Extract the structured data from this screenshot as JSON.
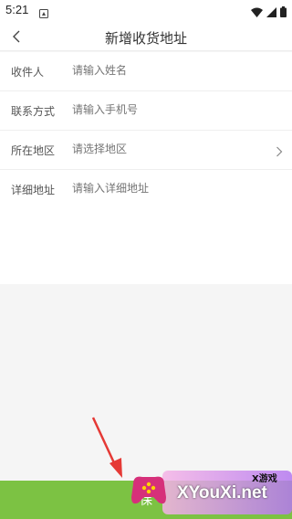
{
  "status_bar": {
    "time": "5:21"
  },
  "header": {
    "title": "新增收货地址"
  },
  "form": {
    "rows": [
      {
        "label": "收件人",
        "placeholder": "请输入姓名"
      },
      {
        "label": "联系方式",
        "placeholder": "请输入手机号"
      },
      {
        "label": "所在地区",
        "placeholder": "请选择地区"
      },
      {
        "label": "详细地址",
        "placeholder": "请输入详细地址"
      }
    ]
  },
  "footer": {
    "save_label": "保"
  },
  "watermark": {
    "tag": "X游戏",
    "site": "XYouXi.net"
  },
  "colors": {
    "accent_green": "#7cc243",
    "annotation_red": "#e53935"
  }
}
